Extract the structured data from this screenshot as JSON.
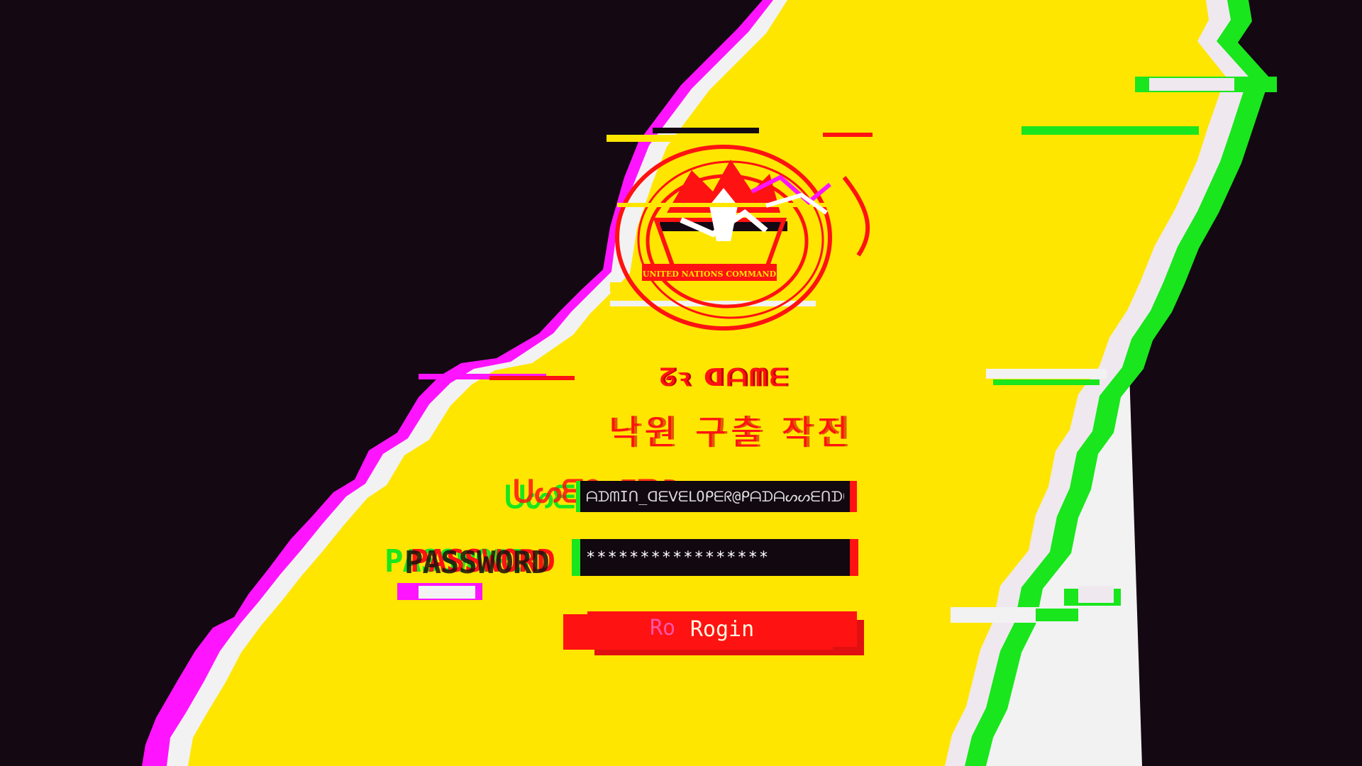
{
  "colors": {
    "background": "#140812",
    "panel": "#ffe600",
    "accent_red": "#ff1212",
    "glitch_green": "#19e61c",
    "glitch_magenta": "#ff14ff"
  },
  "logo": {
    "icon": "united-nations-command-emblem",
    "banner_text": "UNITED NATIONS COMMAND"
  },
  "header": {
    "label": "ᘔꝛ ᗡᗩᗰᗴ",
    "title": "낙원 구출 작전",
    "title_suffix": "_"
  },
  "form": {
    "username_label": "ᑌᔕᗴᖇ IᗪD",
    "username_value": "ᗩᗪᗰIᑎ_ᗡᗴᐯᗴᒪOᑭᗴᖇ@ᑭᗩᗪᗩᔕᔕᗴᑎᗪO.ᑎᗴT",
    "password_label": "PASSWORD",
    "password_value": "*****************",
    "login_label": "Rogin",
    "login_ghost_label": "Ro"
  }
}
